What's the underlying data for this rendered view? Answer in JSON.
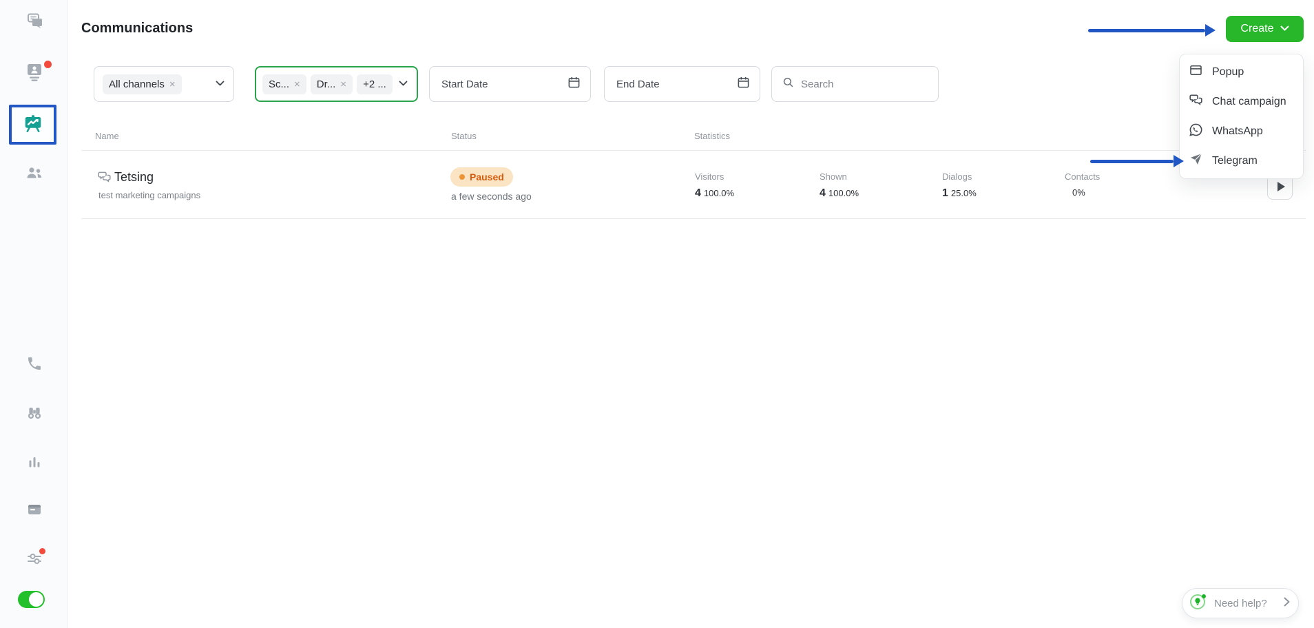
{
  "app": {
    "title": "Communications"
  },
  "header": {
    "create_button": "Create"
  },
  "sidebar": {
    "items": [
      {
        "icon": "conversations-icon"
      },
      {
        "icon": "contacts-icon",
        "notification": true
      },
      {
        "icon": "campaigns-icon",
        "active": true
      },
      {
        "icon": "visitors-icon"
      },
      {
        "icon": "calls-icon"
      },
      {
        "icon": "tracking-icon"
      },
      {
        "icon": "reports-icon"
      },
      {
        "icon": "billing-icon"
      },
      {
        "icon": "settings-icon",
        "notification": true
      }
    ],
    "toggle_state": "on"
  },
  "filters": {
    "channels_chip": "All channels",
    "type_chips": [
      "Sc...",
      "Dr...",
      "+2 ..."
    ],
    "start_date_placeholder": "Start Date",
    "end_date_placeholder": "End Date",
    "search_placeholder": "Search"
  },
  "glyphs": {
    "close": "×",
    "help_chevron": "›"
  },
  "table": {
    "headers": {
      "name": "Name",
      "status": "Status",
      "statistics": "Statistics"
    },
    "row": {
      "name": "Tetsing",
      "subtitle": "test marketing campaigns",
      "status_label": "Paused",
      "status_time": "a few seconds ago",
      "stats": [
        {
          "label": "Visitors",
          "value": "4",
          "percent": "100.0%"
        },
        {
          "label": "Shown",
          "value": "4",
          "percent": "100.0%"
        },
        {
          "label": "Dialogs",
          "value": "1",
          "percent": "25.0%"
        },
        {
          "label": "Contacts",
          "value": "",
          "percent": "0%"
        }
      ]
    }
  },
  "create_menu": {
    "items": [
      {
        "icon": "popup-icon",
        "label": "Popup"
      },
      {
        "icon": "chat-campaign-icon",
        "label": "Chat campaign"
      },
      {
        "icon": "whatsapp-icon",
        "label": "WhatsApp"
      },
      {
        "icon": "telegram-icon",
        "label": "Telegram"
      }
    ]
  },
  "help_widget": {
    "label": "Need help?"
  },
  "colors": {
    "accent_green": "#28b62b",
    "highlight_blue": "#2157c4",
    "active_teal": "#14a092",
    "filter_active_border": "#2aa44b",
    "badge_bg": "#fbe4c3",
    "badge_text": "#d65c0e",
    "notification_red": "#f4493d",
    "toggle_green": "#23c02c"
  }
}
